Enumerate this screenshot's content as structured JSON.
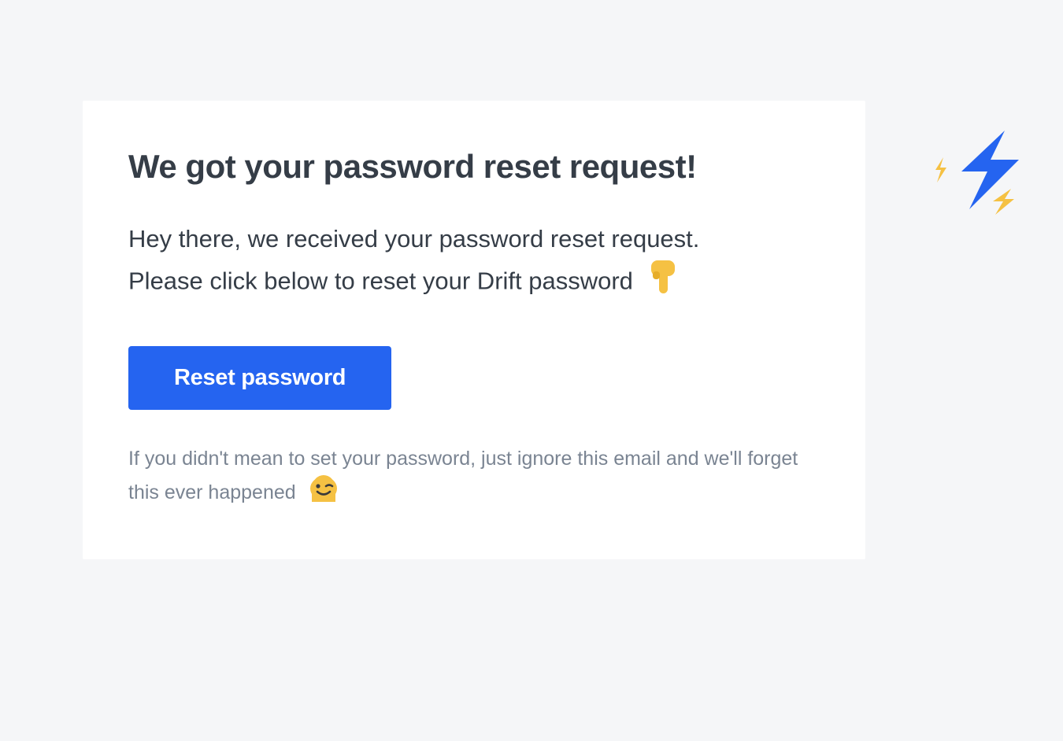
{
  "email": {
    "heading": "We got your password reset request!",
    "body_line1": "Hey there, we received your password reset request.",
    "body_line2": "Please click below to reset your Drift password",
    "button_label": "Reset password",
    "footer_line": "If you didn't mean to set your password, just ignore this email and we'll forget this ever happened"
  },
  "colors": {
    "accent_blue": "#2564f0",
    "accent_yellow": "#f5c143",
    "text_dark": "#353d47",
    "text_muted": "#7a8492",
    "background": "#f5f6f8"
  }
}
